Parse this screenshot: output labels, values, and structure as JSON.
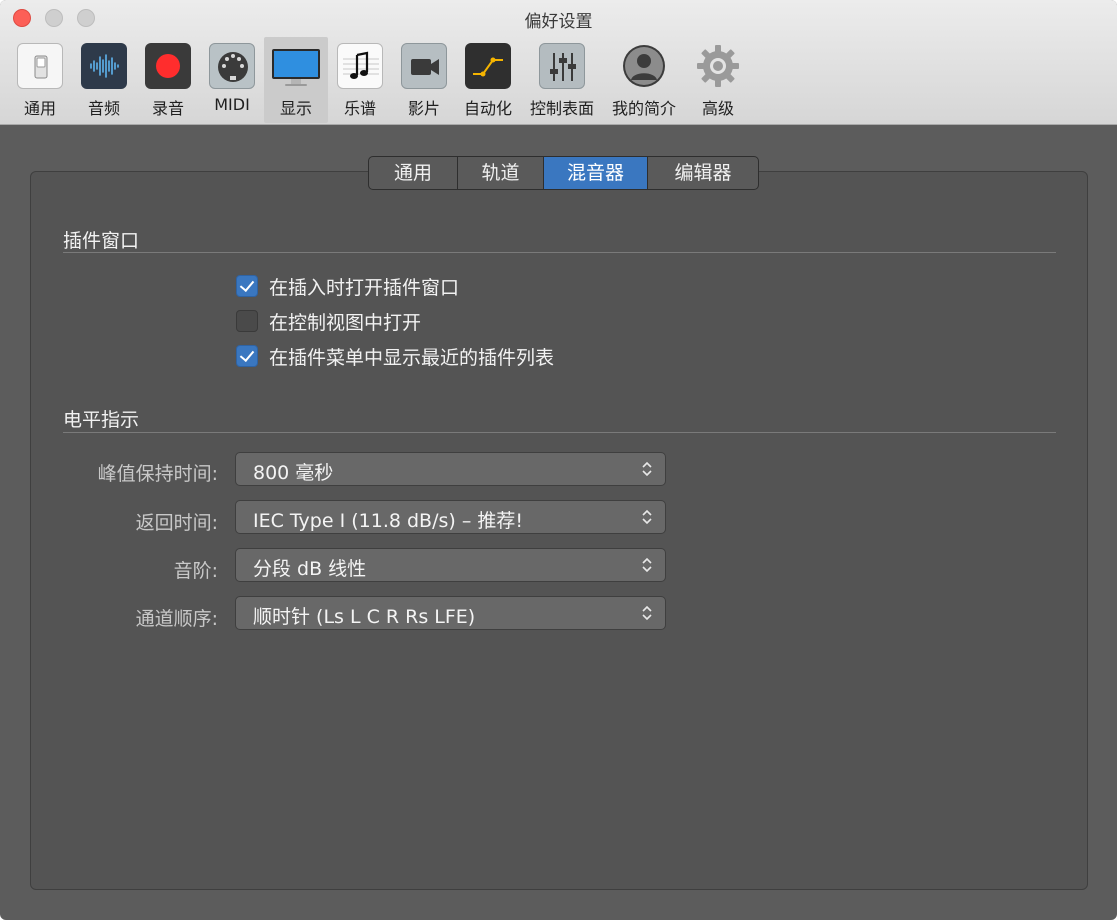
{
  "window": {
    "title": "偏好设置"
  },
  "toolbar": {
    "items": [
      {
        "label": "通用",
        "icon": "switch-icon"
      },
      {
        "label": "音频",
        "icon": "waveform-icon"
      },
      {
        "label": "录音",
        "icon": "record-icon"
      },
      {
        "label": "MIDI",
        "icon": "midi-connector-icon"
      },
      {
        "label": "显示",
        "icon": "display-icon"
      },
      {
        "label": "乐谱",
        "icon": "music-note-icon"
      },
      {
        "label": "影片",
        "icon": "video-camera-icon"
      },
      {
        "label": "自动化",
        "icon": "automation-curve-icon"
      },
      {
        "label": "控制表面",
        "icon": "fader-icon"
      },
      {
        "label": "我的简介",
        "icon": "profile-icon"
      },
      {
        "label": "高级",
        "icon": "gear-icon"
      }
    ],
    "selected": "显示"
  },
  "tabs": {
    "items": [
      "通用",
      "轨道",
      "混音器",
      "编辑器"
    ],
    "active": "混音器"
  },
  "plugin_window": {
    "title": "插件窗口",
    "options": [
      {
        "label": "在插入时打开插件窗口",
        "checked": true
      },
      {
        "label": "在控制视图中打开",
        "checked": false
      },
      {
        "label": "在插件菜单中显示最近的插件列表",
        "checked": true
      }
    ]
  },
  "meters": {
    "title": "电平指示",
    "fields": [
      {
        "label": "峰值保持时间:",
        "value": "800 毫秒"
      },
      {
        "label": "返回时间:",
        "value": "IEC Type I (11.8 dB/s) – 推荐!"
      },
      {
        "label": "音阶:",
        "value": "分段 dB 线性"
      },
      {
        "label": "通道顺序:",
        "value": "顺时针 (Ls L C R Rs LFE)"
      }
    ]
  },
  "colors": {
    "accent": "#3a77c0",
    "content_bg": "#545454",
    "window_bg": "#5c5c5c"
  }
}
